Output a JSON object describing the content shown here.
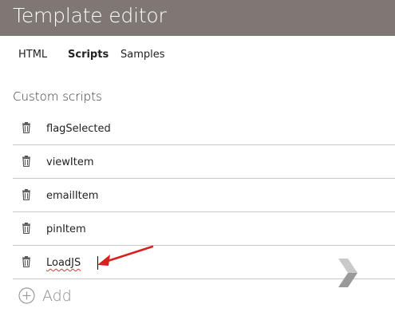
{
  "window": {
    "title": "Template editor"
  },
  "tabs": [
    {
      "label": "HTML",
      "active": false
    },
    {
      "label": "Scripts",
      "active": true
    },
    {
      "label": "Samples",
      "active": false
    }
  ],
  "section": {
    "label": "Custom scripts"
  },
  "scripts": [
    {
      "name": "flagSelected",
      "icon": "trash-icon"
    },
    {
      "name": "viewItem",
      "icon": "trash-icon"
    },
    {
      "name": "emailItem",
      "icon": "trash-icon"
    },
    {
      "name": "pinItem",
      "icon": "trash-icon"
    },
    {
      "name": "LoadJS",
      "icon": "trash-icon",
      "editing": true
    }
  ],
  "add": {
    "label": "Add",
    "icon": "plus-circle-icon"
  },
  "colors": {
    "titlebar": "#7f7774",
    "annotation_arrow": "#d9201c",
    "spellcheck": "#dd3333"
  }
}
